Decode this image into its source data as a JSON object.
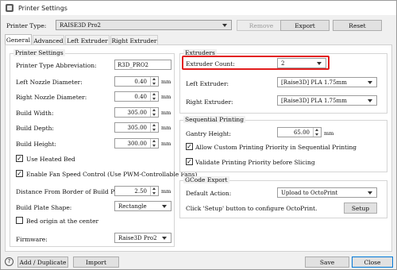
{
  "window": {
    "title": "Printer Settings"
  },
  "top": {
    "printer_type_label": "Printer Type:",
    "printer_type_value": "RAISE3D Pro2",
    "remove_label": "Remove",
    "export_label": "Export",
    "reset_label": "Reset"
  },
  "tabs": [
    {
      "label": "General",
      "active": true
    },
    {
      "label": "Advanced",
      "active": false
    },
    {
      "label": "Left Extruder",
      "active": false
    },
    {
      "label": "Right Extruder",
      "active": false
    }
  ],
  "printer_settings": {
    "title": "Printer Settings",
    "abbrev_label": "Printer Type Abbreviation:",
    "abbrev_value": "R3D_PRO2",
    "left_nozzle_label": "Left Nozzle Diameter:",
    "left_nozzle_value": "0.40",
    "right_nozzle_label": "Right Nozzle Diameter:",
    "right_nozzle_value": "0.40",
    "build_width_label": "Build Width:",
    "build_width_value": "305.00",
    "build_depth_label": "Build Depth:",
    "build_depth_value": "305.00",
    "build_height_label": "Build Height:",
    "build_height_value": "300.00",
    "unit_mm": "mm",
    "heated_bed_label": "Use Heated Bed",
    "heated_bed_checked": true,
    "fan_speed_label": "Enable Fan Speed Control (Use PWM-Controllable Fans)",
    "fan_speed_checked": true,
    "distance_border_label": "Distance From Border of Build Plate:",
    "distance_border_value": "2.50",
    "plate_shape_label": "Build Plate Shape:",
    "plate_shape_value": "Rectangle",
    "origin_center_label": "Bed origin at the center",
    "origin_center_checked": false,
    "firmware_label": "Firmware:",
    "firmware_value": "Raise3D Pro2"
  },
  "extruders": {
    "title": "Extruders",
    "count_label": "Extruder Count:",
    "count_value": "2",
    "left_label": "Left Extruder:",
    "left_value": "[Raise3D] PLA 1.75mm",
    "right_label": "Right Extruder:",
    "right_value": "[Raise3D] PLA 1.75mm"
  },
  "sequential": {
    "title": "Sequential Printing",
    "gantry_label": "Gantry Height:",
    "gantry_value": "65.00",
    "custom_priority_label": "Allow Custom Printing Priority in Sequential Printing",
    "custom_priority_checked": true,
    "validate_priority_label": "Validate Printing Priority before Slicing",
    "validate_priority_checked": true
  },
  "gcode": {
    "title": "GCode Export",
    "default_action_label": "Default Action:",
    "default_action_value": "Upload to OctoPrint",
    "hint": "Click 'Setup' button to configure OctoPrint.",
    "setup_label": "Setup"
  },
  "bottom": {
    "help_symbol": "?",
    "add_duplicate_label": "Add / Duplicate",
    "import_label": "Import",
    "save_label": "Save",
    "close_label": "Close"
  },
  "colors": {
    "highlight": "#e21d1d",
    "accent": "#0078d7"
  }
}
